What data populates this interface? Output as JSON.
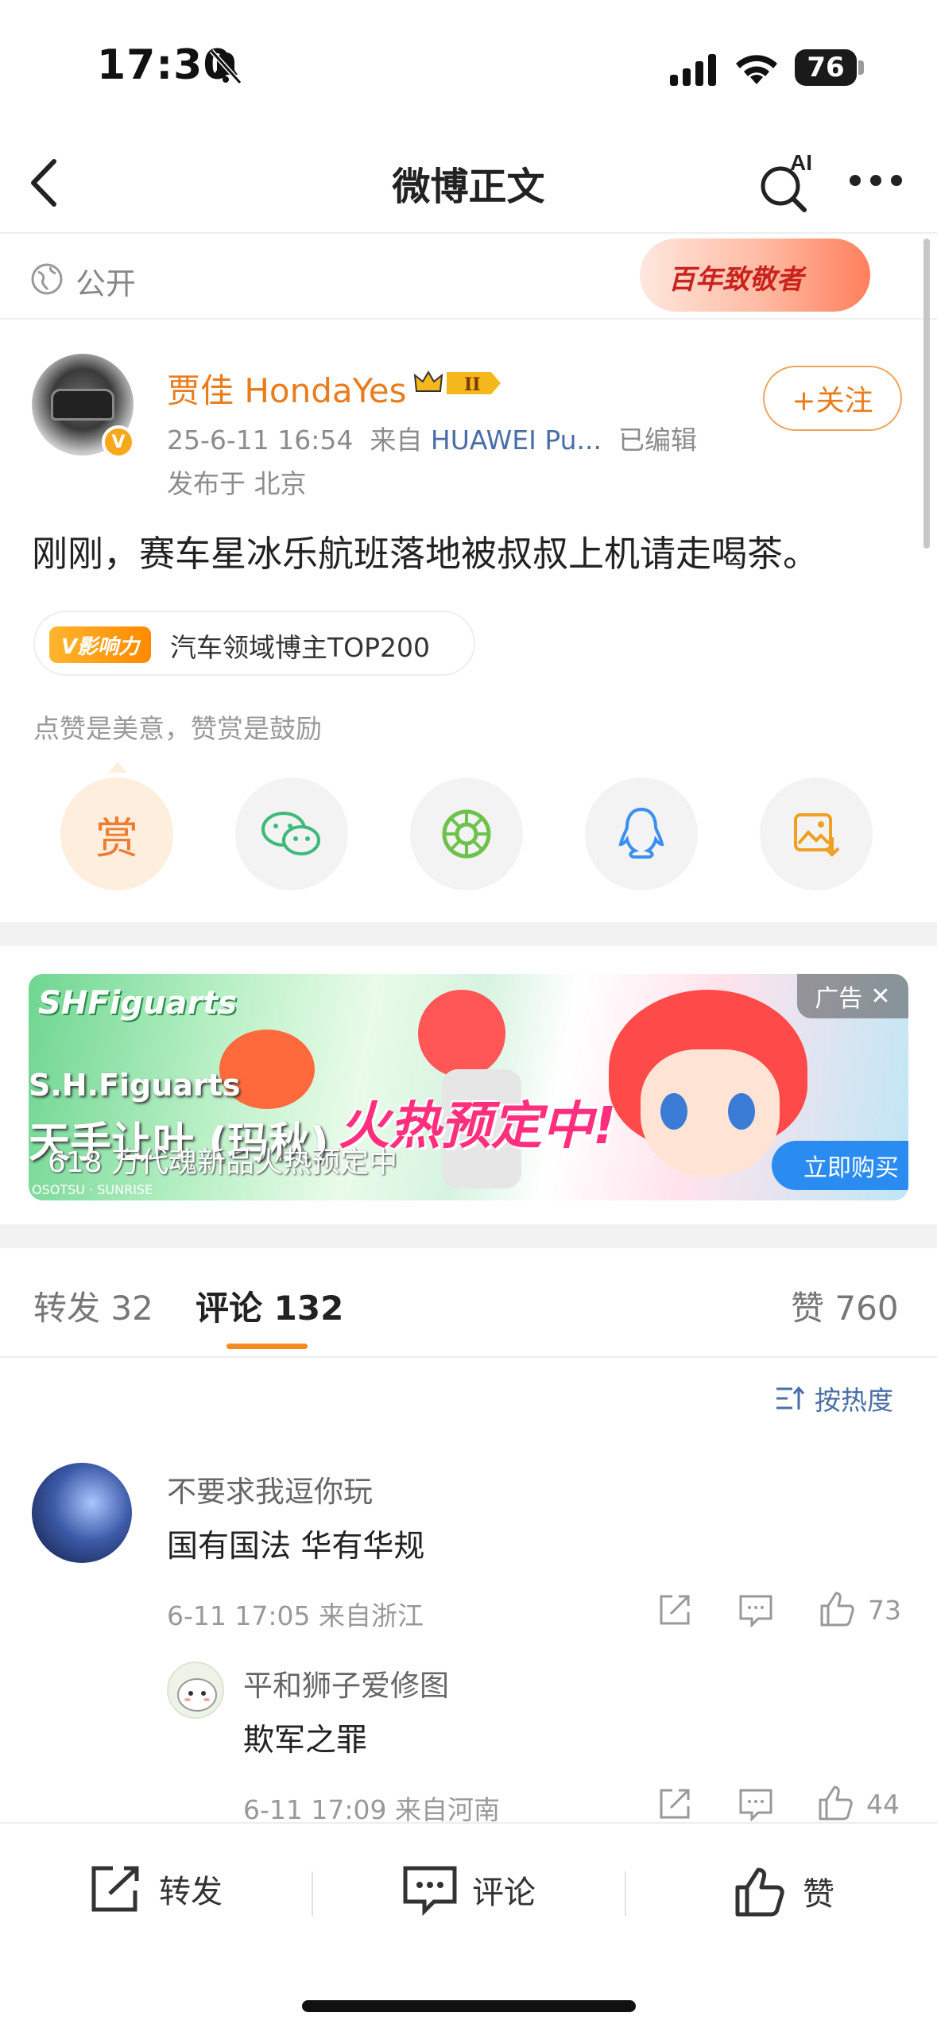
{
  "status_bar": {
    "time": "17:30",
    "battery": "76"
  },
  "nav": {
    "title": "微博正文",
    "ai_label": "AI"
  },
  "visibility": {
    "label": "公开",
    "banner_text": "百年致敬者"
  },
  "post": {
    "author": "贾佳 HondaYes",
    "level": "II",
    "date": "25-6-11 16:54",
    "from_prefix": "来自",
    "source": "HUAWEI Pu...",
    "edited": "已编辑",
    "location": "发布于 北京",
    "follow_label": "+关注",
    "text": "刚刚，赛车星冰乐航班落地被叔叔上机请走喝茶。",
    "influence_logo": "V影响力",
    "influence_label": "汽车领域博主TOP200",
    "reward_hint": "点赞是美意，赞赏是鼓励",
    "reward_label": "赏"
  },
  "ad": {
    "brand": "SHFiguarts",
    "line1": "S.H.Figuarts",
    "line2": "天手让叶 (玛秋)",
    "headline": "火热预定中!",
    "sub": "618 万代魂新品火热预定中",
    "tag": "广告",
    "cta": "立即购买",
    "sponsor": "OSOTSU · SUNRISE"
  },
  "tabs": {
    "repost_label": "转发",
    "repost_count": "32",
    "comments_label": "评论",
    "comments_count": "132",
    "likes_label": "赞",
    "likes_count": "760"
  },
  "sort_label": "按热度",
  "comments": [
    {
      "user": "不要求我逗你玩",
      "text": "国有国法 华有华规",
      "meta": "6-11 17:05 来自浙江",
      "likes": "73"
    },
    {
      "user": "平和狮子爱修图",
      "text": "欺军之罪",
      "meta": "6-11 17:09 来自河南",
      "likes": "44"
    }
  ],
  "bottom_bar": {
    "repost": "转发",
    "comment": "评论",
    "like": "赞"
  },
  "colors": {
    "accent": "#ea7c1b",
    "link": "#4a6ea8",
    "tab_indicator": "#f58a22",
    "cta": "#2a8cf0"
  }
}
